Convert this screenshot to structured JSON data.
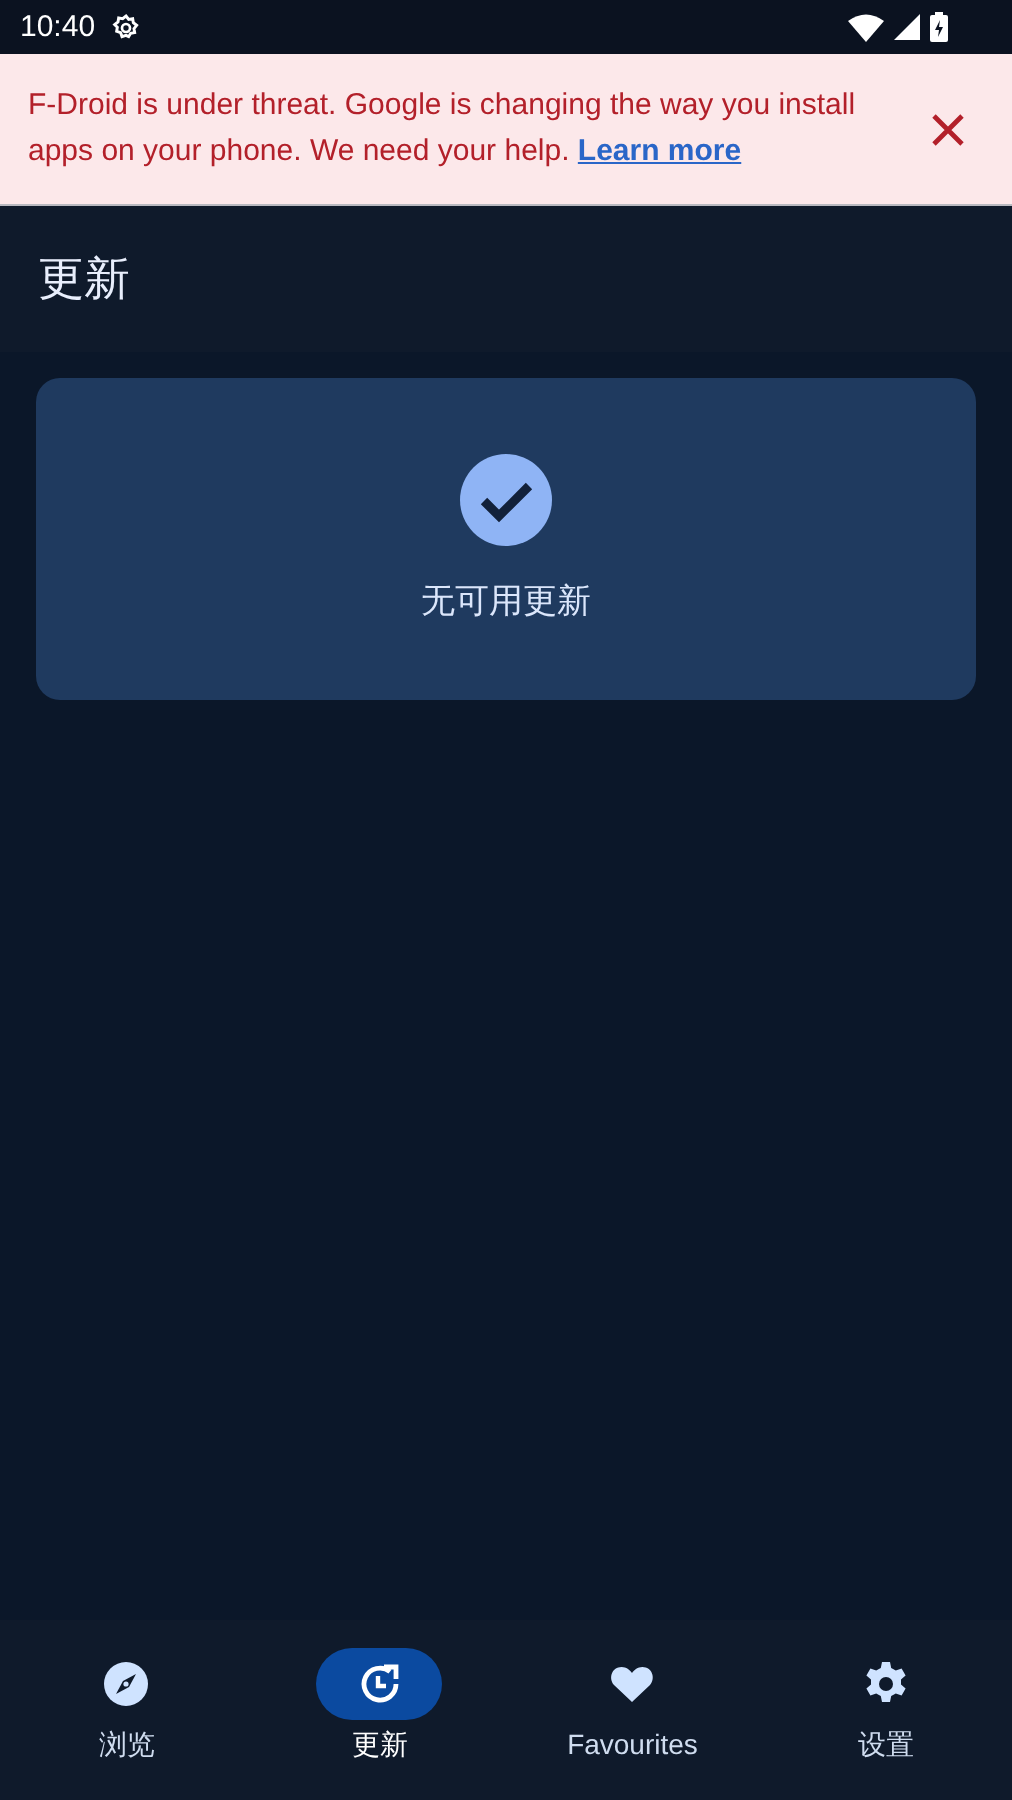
{
  "status_bar": {
    "time": "10:40"
  },
  "banner": {
    "text": "F-Droid is under threat. Google is changing the way you install apps on your phone. We need your help.",
    "link": "Learn more"
  },
  "app_bar": {
    "title": "更新"
  },
  "empty_state": {
    "message": "无可用更新"
  },
  "bottom_nav": [
    {
      "kind": "compass",
      "label": "浏览",
      "selected": false
    },
    {
      "kind": "updates",
      "label": "更新",
      "selected": true
    },
    {
      "kind": "heart",
      "label": "Favourites",
      "selected": false
    },
    {
      "kind": "gear",
      "label": "设置",
      "selected": false
    }
  ]
}
